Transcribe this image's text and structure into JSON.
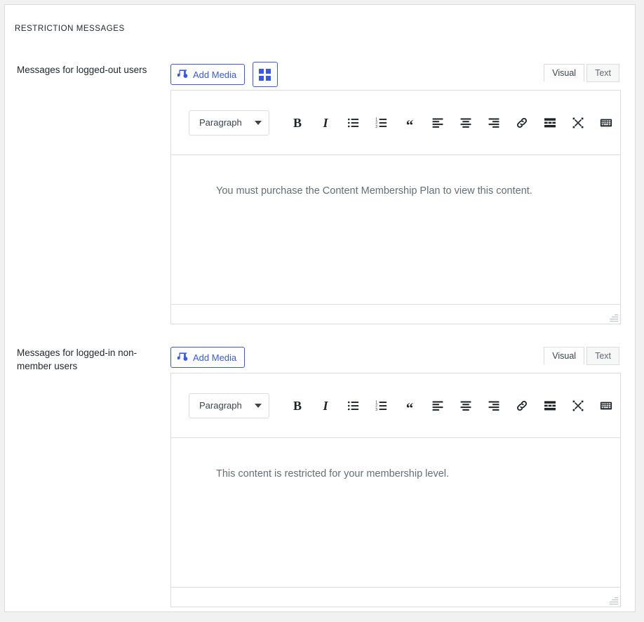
{
  "section": {
    "heading": "RESTRICTION MESSAGES"
  },
  "fields": [
    {
      "label": "Messages for logged-out users",
      "add_media_label": "Add Media",
      "add_media_icon": "media-add-icon",
      "has_blocks_button": true,
      "blocks_icon": "grid-blocks-icon",
      "tabs": [
        {
          "label": "Visual",
          "active": true
        },
        {
          "label": "Text",
          "active": false
        }
      ],
      "format_select": "Paragraph",
      "content": "You must purchase the Content Membership Plan to view this content."
    },
    {
      "label": "Messages for logged-in non-member users",
      "add_media_label": "Add Media",
      "add_media_icon": "media-add-icon",
      "has_blocks_button": false,
      "blocks_icon": "grid-blocks-icon",
      "tabs": [
        {
          "label": "Visual",
          "active": true
        },
        {
          "label": "Text",
          "active": false
        }
      ],
      "format_select": "Paragraph",
      "content": "This content is restricted for your membership level."
    }
  ],
  "toolbar_buttons": [
    {
      "name": "bold-icon",
      "glyph": "B",
      "kind": "bold"
    },
    {
      "name": "italic-icon",
      "glyph": "I",
      "kind": "italic"
    },
    {
      "name": "bulleted-list-icon",
      "glyph": "",
      "kind": "ul"
    },
    {
      "name": "numbered-list-icon",
      "glyph": "",
      "kind": "ol"
    },
    {
      "name": "blockquote-icon",
      "glyph": "“",
      "kind": "quote"
    },
    {
      "name": "align-left-icon",
      "glyph": "",
      "kind": "align-left"
    },
    {
      "name": "align-center-icon",
      "glyph": "",
      "kind": "align-center"
    },
    {
      "name": "align-right-icon",
      "glyph": "",
      "kind": "align-right"
    },
    {
      "name": "insert-link-icon",
      "glyph": "",
      "kind": "link"
    },
    {
      "name": "read-more-icon",
      "glyph": "",
      "kind": "more"
    },
    {
      "name": "fullscreen-icon",
      "glyph": "",
      "kind": "fullscreen"
    },
    {
      "name": "toolbar-toggle-icon",
      "glyph": "",
      "kind": "keyboard"
    }
  ],
  "colors": {
    "accent": "#3858e9",
    "border": "#dcdcde",
    "text": "#23282d",
    "muted_text": "#666e72",
    "page_bg": "#f1f1f1",
    "panel_bg": "#ffffff"
  }
}
